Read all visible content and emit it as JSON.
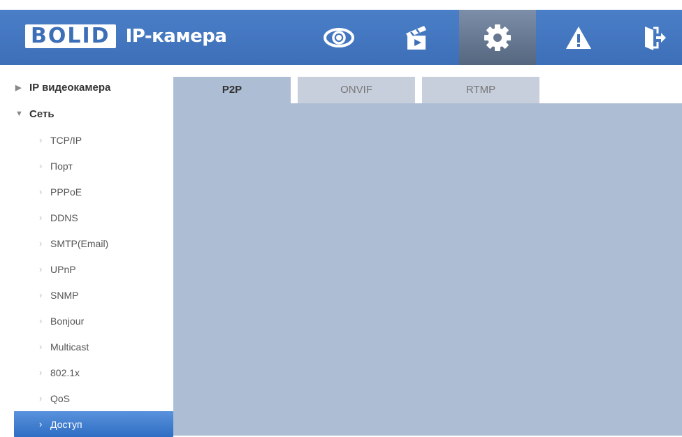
{
  "header": {
    "logo_brand": "BOLID",
    "logo_product": "IP-камера",
    "nav": [
      {
        "icon": "eye-icon"
      },
      {
        "icon": "clapperboard-icon"
      },
      {
        "icon": "gear-icon",
        "active": true
      },
      {
        "icon": "warning-icon"
      },
      {
        "icon": "exit-icon"
      }
    ]
  },
  "sidebar": {
    "sections": [
      {
        "label": "IP видеокамера",
        "expanded": false,
        "marker": "▶"
      },
      {
        "label": "Сеть",
        "expanded": true,
        "marker": "▼"
      }
    ],
    "items": [
      {
        "label": "TCP/IP"
      },
      {
        "label": "Порт"
      },
      {
        "label": "PPPoE"
      },
      {
        "label": "DDNS"
      },
      {
        "label": "SMTP(Email)"
      },
      {
        "label": "UPnP"
      },
      {
        "label": "SNMP"
      },
      {
        "label": "Bonjour"
      },
      {
        "label": "Multicast"
      },
      {
        "label": "802.1x"
      },
      {
        "label": "QoS"
      },
      {
        "label": "Доступ",
        "active": true
      }
    ],
    "chevron": "›"
  },
  "content": {
    "tabs": [
      {
        "label": "P2P",
        "active": true
      },
      {
        "label": "ONVIF"
      },
      {
        "label": "RTMP"
      }
    ]
  },
  "colors": {
    "header_blue": "#3d6fb8",
    "active_nav": "#55667f",
    "active_item": "#2f6dc4",
    "content_bg": "#adbdd4"
  }
}
